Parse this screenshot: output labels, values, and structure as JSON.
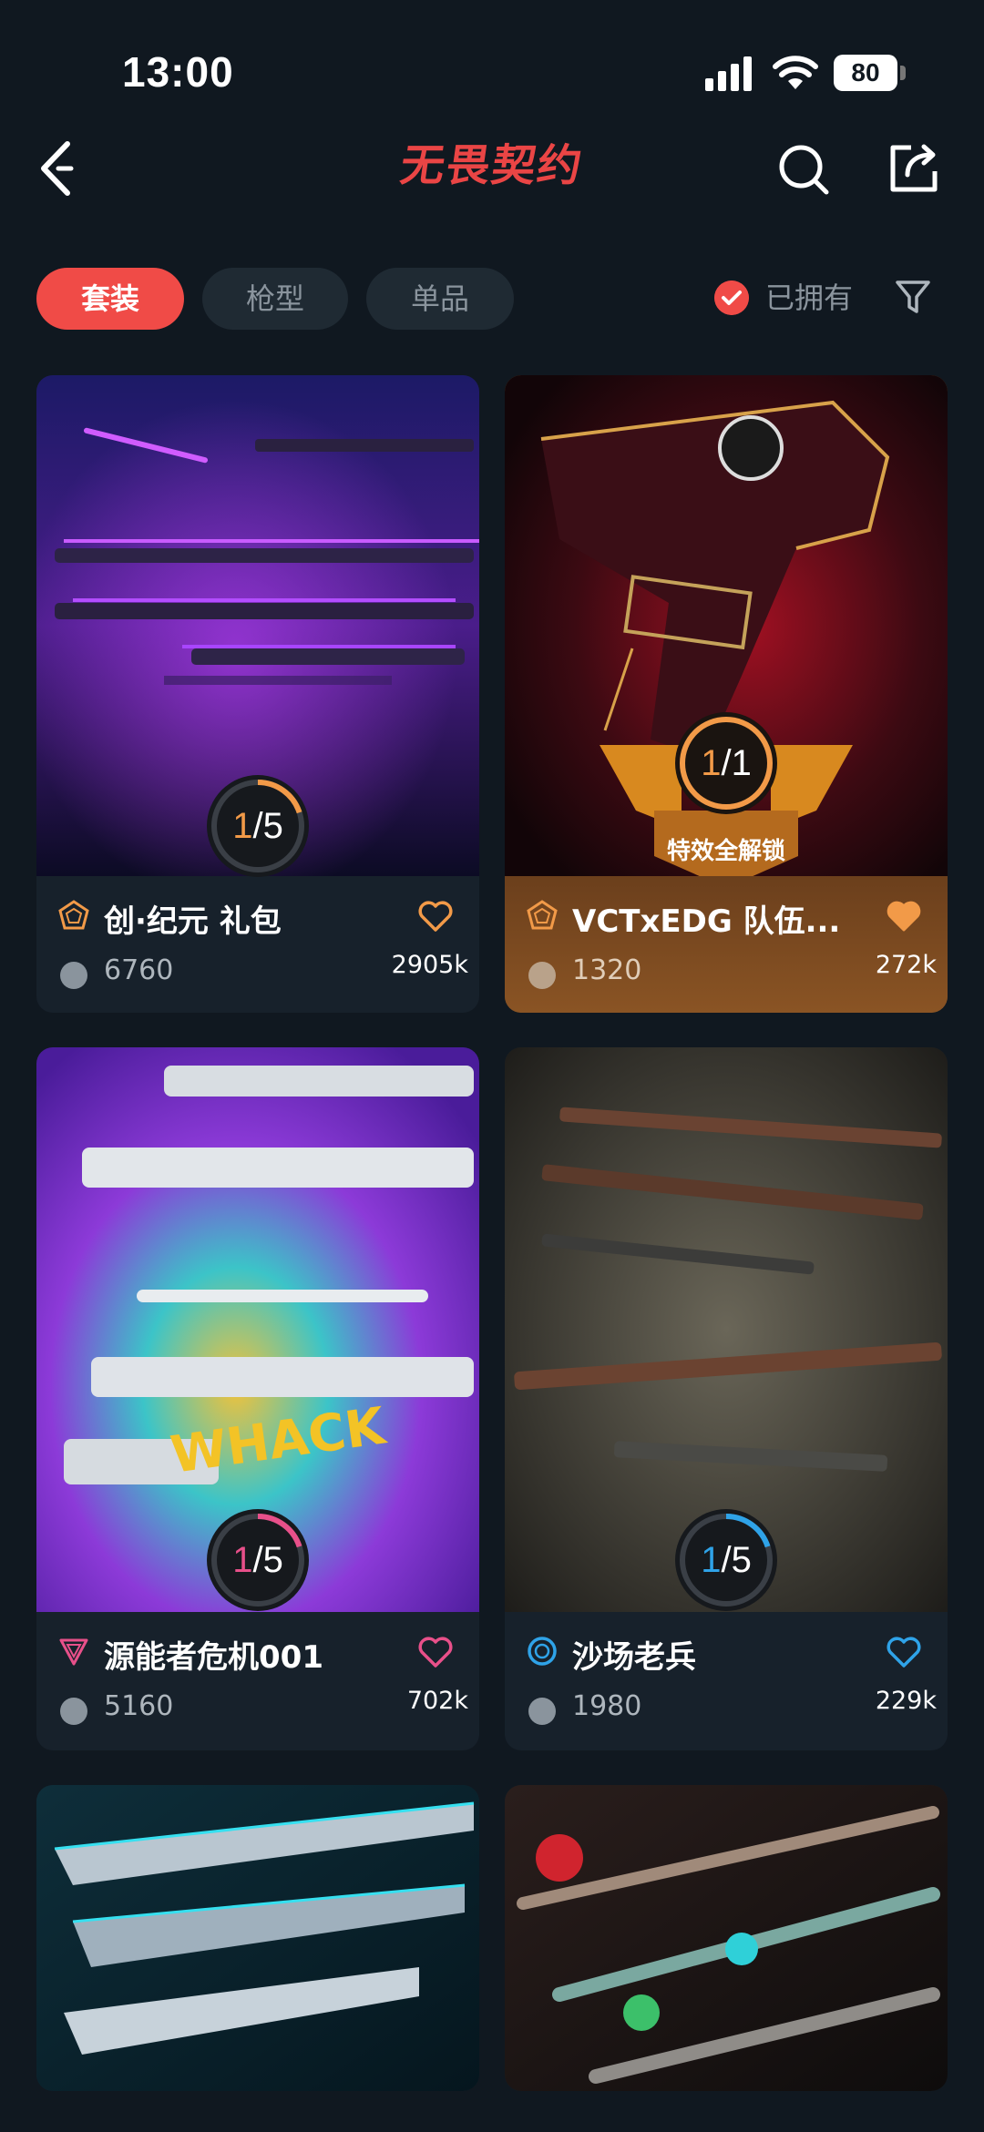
{
  "status_bar": {
    "time": "13:00",
    "battery": "80"
  },
  "header": {
    "title": "无畏契约",
    "back_icon": "chevron-left-icon",
    "search_icon": "search-icon",
    "share_icon": "share-icon"
  },
  "filters": {
    "tabs": [
      {
        "label": "套装",
        "active": true
      },
      {
        "label": "枪型",
        "active": false
      },
      {
        "label": "单品",
        "active": false
      }
    ],
    "owned_label": "已拥有",
    "owned_checked": true
  },
  "cards": [
    {
      "name": "创·纪元 礼包",
      "price": "6760",
      "likes": "2905k",
      "progress": "1/5",
      "progress_current": "1",
      "progress_total": "5",
      "accent": "#f29a48",
      "heart_filled": false,
      "owned": false
    },
    {
      "name": "VCTxEDG 队伍...",
      "price": "1320",
      "likes": "272k",
      "progress": "1/1",
      "progress_current": "1",
      "progress_total": "1",
      "badge": "特效全解锁",
      "accent": "#f29a48",
      "heart_filled": true,
      "owned": true
    },
    {
      "name": "源能者危机001",
      "price": "5160",
      "likes": "702k",
      "progress": "1/5",
      "progress_current": "1",
      "progress_total": "5",
      "accent": "#e8508a",
      "heart_filled": false,
      "owned": false
    },
    {
      "name": "沙场老兵",
      "price": "1980",
      "likes": "229k",
      "progress": "1/5",
      "progress_current": "1",
      "progress_total": "5",
      "accent": "#2fa3e8",
      "heart_filled": false,
      "owned": false
    },
    {
      "name": "",
      "price": "",
      "likes": ""
    },
    {
      "name": "",
      "price": "",
      "likes": ""
    }
  ]
}
